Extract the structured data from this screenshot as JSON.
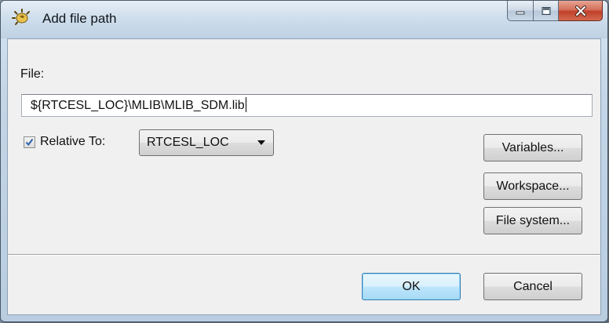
{
  "window": {
    "title": "Add file path",
    "app_icon": "eclipse-sun-icon",
    "caption_buttons": [
      "minimize-icon",
      "maximize-icon",
      "close-icon"
    ]
  },
  "form": {
    "file_label": "File:",
    "file_path_value": "${RTCESL_LOC}\\MLIB\\MLIB_SDM.lib",
    "relative_checkbox_checked": true,
    "relative_label": "Relative To:",
    "relative_select_value": "RTCESL_LOC"
  },
  "side_buttons": {
    "variables": "Variables...",
    "workspace": "Workspace...",
    "file_system": "File system..."
  },
  "footer": {
    "ok": "OK",
    "cancel": "Cancel"
  },
  "colors": {
    "close_button": "#c0402a",
    "default_button_border": "#3c7fb1",
    "checkbox_check": "#2a5fa8"
  }
}
